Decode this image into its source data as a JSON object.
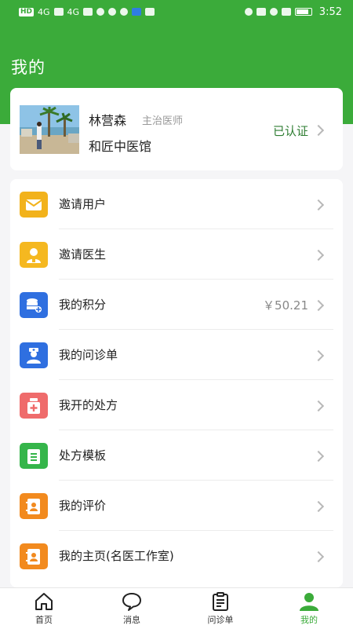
{
  "status_bar": {
    "left_tags": [
      "HD",
      "4G",
      "4G"
    ],
    "time": "3:52"
  },
  "header": {
    "title": "我的",
    "accent_color": "#3bab3a"
  },
  "profile": {
    "name": "林营森",
    "title": "主治医师",
    "hospital": "和匠中医馆",
    "verified_label": "已认证"
  },
  "menu": {
    "items": [
      {
        "label": "邀请用户",
        "icon": "envelope-icon",
        "color": "#f2b21b"
      },
      {
        "label": "邀请医生",
        "icon": "doctor-icon",
        "color": "#f5b820"
      },
      {
        "label": "我的积分",
        "icon": "coins-icon",
        "color": "#2f6fe0",
        "value": "￥50.21"
      },
      {
        "label": "我的问诊单",
        "icon": "nurse-icon",
        "color": "#2f6fe0"
      },
      {
        "label": "我开的处方",
        "icon": "medicine-icon",
        "color": "#ef6b6b"
      },
      {
        "label": "处方模板",
        "icon": "clipboard-icon",
        "color": "#35b54a"
      },
      {
        "label": "我的评价",
        "icon": "contact-card-icon",
        "color": "#f28a1e"
      },
      {
        "label": "我的主页(名医工作室)",
        "icon": "contact-card-icon",
        "color": "#f28a1e"
      }
    ]
  },
  "tabbar": {
    "tabs": [
      {
        "label": "首页",
        "icon": "home-icon"
      },
      {
        "label": "消息",
        "icon": "chat-bubble-icon"
      },
      {
        "label": "问诊单",
        "icon": "clipboard-icon"
      },
      {
        "label": "我的",
        "icon": "person-icon",
        "active": true
      }
    ]
  }
}
